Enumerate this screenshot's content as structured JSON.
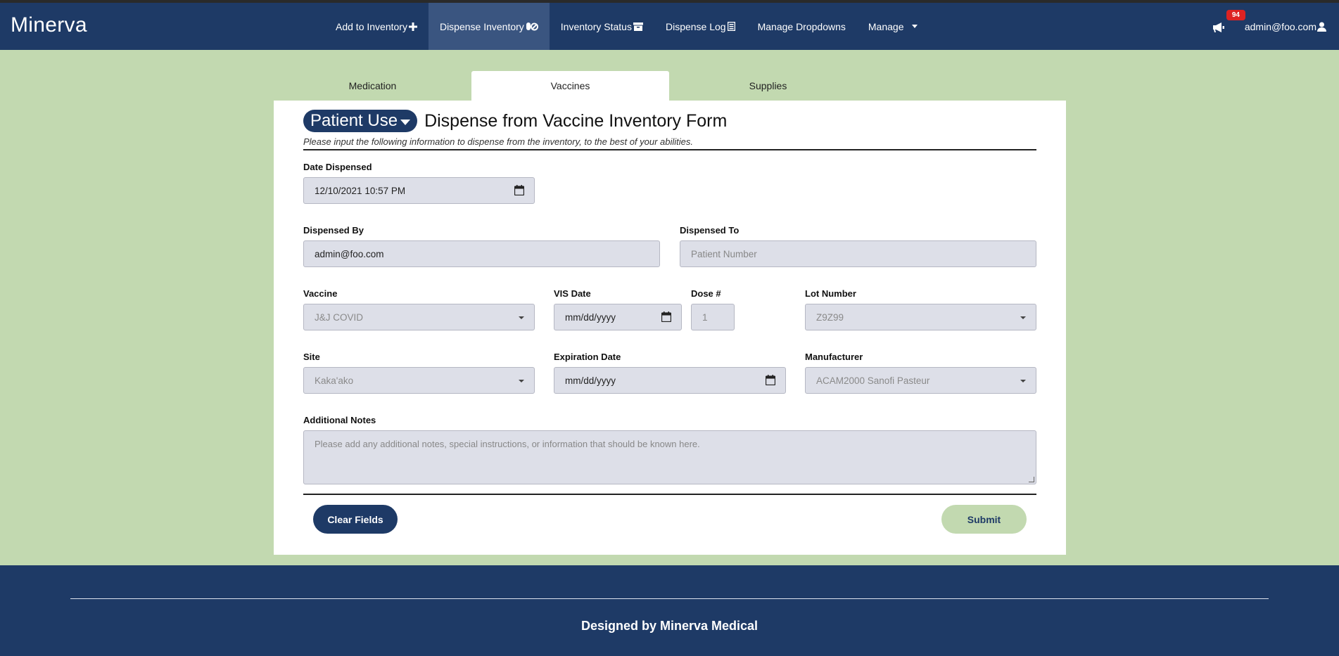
{
  "app": {
    "brand": "Minerva"
  },
  "nav": {
    "items": [
      {
        "label": "Add to Inventory",
        "icon": "plus-icon",
        "active": false
      },
      {
        "label": "Dispense Inventory",
        "icon": "pills-icon",
        "active": true
      },
      {
        "label": "Inventory Status",
        "icon": "archive-icon",
        "active": false
      },
      {
        "label": "Dispense Log",
        "icon": "log-icon",
        "active": false
      },
      {
        "label": "Manage Dropdowns",
        "icon": "",
        "active": false
      },
      {
        "label": "Manage",
        "icon": "chevron-down-icon",
        "active": false
      }
    ],
    "notifications": {
      "icon": "megaphone-icon",
      "count": "94"
    },
    "user": {
      "label": "admin@foo.com",
      "icon": "user-icon"
    }
  },
  "tabs": [
    {
      "label": "Medication",
      "active": false
    },
    {
      "label": "Vaccines",
      "active": true
    },
    {
      "label": "Supplies",
      "active": false
    }
  ],
  "form": {
    "mode_label": "Patient Use",
    "title": "Dispense from Vaccine Inventory Form",
    "subtitle": "Please input the following information to dispense from the inventory, to the best of your abilities.",
    "date_dispensed": {
      "label": "Date Dispensed",
      "value": "12/10/2021 10:57 PM"
    },
    "dispensed_by": {
      "label": "Dispensed By",
      "value": "admin@foo.com"
    },
    "dispensed_to": {
      "label": "Dispensed To",
      "placeholder": "Patient Number"
    },
    "vaccine": {
      "label": "Vaccine",
      "value": "J&J COVID"
    },
    "vis_date": {
      "label": "VIS Date",
      "value": "mm/dd/yyyy"
    },
    "dose": {
      "label": "Dose #",
      "placeholder": "1"
    },
    "lot_number": {
      "label": "Lot Number",
      "value": "Z9Z99"
    },
    "site": {
      "label": "Site",
      "value": "Kaka'ako"
    },
    "expiration_date": {
      "label": "Expiration Date",
      "value": "mm/dd/yyyy"
    },
    "manufacturer": {
      "label": "Manufacturer",
      "value": "ACAM2000 Sanofi Pasteur"
    },
    "notes": {
      "label": "Additional Notes",
      "placeholder": "Please add any additional notes, special instructions, or information that should be known here."
    },
    "clear_label": "Clear Fields",
    "submit_label": "Submit"
  },
  "footer": {
    "text": "Designed by Minerva Medical"
  },
  "colors": {
    "primary": "#1e3a66",
    "background": "#c2d9b0",
    "badge": "#dd2222",
    "field": "#dddfe8"
  }
}
